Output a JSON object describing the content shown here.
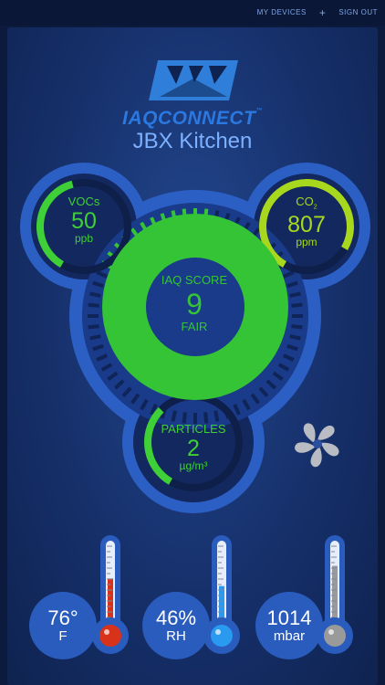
{
  "nav": {
    "my_devices": "MY DEVICES",
    "add": "+",
    "sign_out": "SIGN OUT"
  },
  "brand": {
    "name": "IAQCONNECT",
    "trademark": "™"
  },
  "location": "JBX Kitchen",
  "gauges": {
    "vocs": {
      "name": "VOCs",
      "value": "50",
      "unit": "ppb",
      "level": 0.45,
      "color": "#3fcf36"
    },
    "co2": {
      "name": "CO",
      "sub": "2",
      "value": "807",
      "unit": "ppm",
      "level": 0.9,
      "color": "#a8d81d"
    },
    "particles": {
      "name": "PARTICLES",
      "value": "2",
      "unit": "µg/m³",
      "level": 0.35,
      "color": "#3fcf36"
    }
  },
  "iaq": {
    "label": "IAQ SCORE",
    "value": "9",
    "rating": "FAIR",
    "level": 0.9,
    "color": "#35c435"
  },
  "readings": {
    "temperature": {
      "value": "76°",
      "unit": "F",
      "level": 0.55,
      "color": "#d8321a"
    },
    "humidity": {
      "value": "46%",
      "unit": "RH",
      "level": 0.46,
      "color": "#2a9af0"
    },
    "pressure": {
      "value": "1014",
      "unit": "mbar",
      "level": 0.7,
      "color": "#9a9a9a"
    }
  },
  "icons": {
    "fan": "fan-icon",
    "logo": "logo-mark-icon"
  }
}
